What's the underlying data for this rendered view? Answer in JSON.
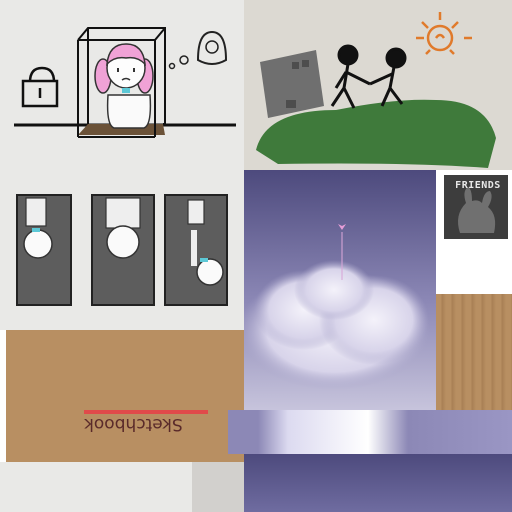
{
  "atlas": {
    "panels": [
      {
        "id": "locked-girl",
        "caption": ""
      },
      {
        "id": "walking-together",
        "caption": ""
      },
      {
        "id": "falling-strip",
        "caption": ""
      },
      {
        "id": "cloud-sky",
        "caption": ""
      }
    ],
    "sketchbook_label": "Sketchbook",
    "friends_label": "FRIENDS"
  },
  "colors": {
    "paper": "#e9e9e7",
    "paper_warm": "#dcd9d2",
    "cardboard": "#b88f62",
    "sky_top": "#4d4a7d",
    "sky_bottom": "#c7c4dc",
    "grass": "#3f7a3b",
    "dark_panel": "#5d5d5d",
    "sun": "#e07a2b",
    "pink_hair": "#f0a2d6",
    "red_line": "#e04a4a"
  }
}
